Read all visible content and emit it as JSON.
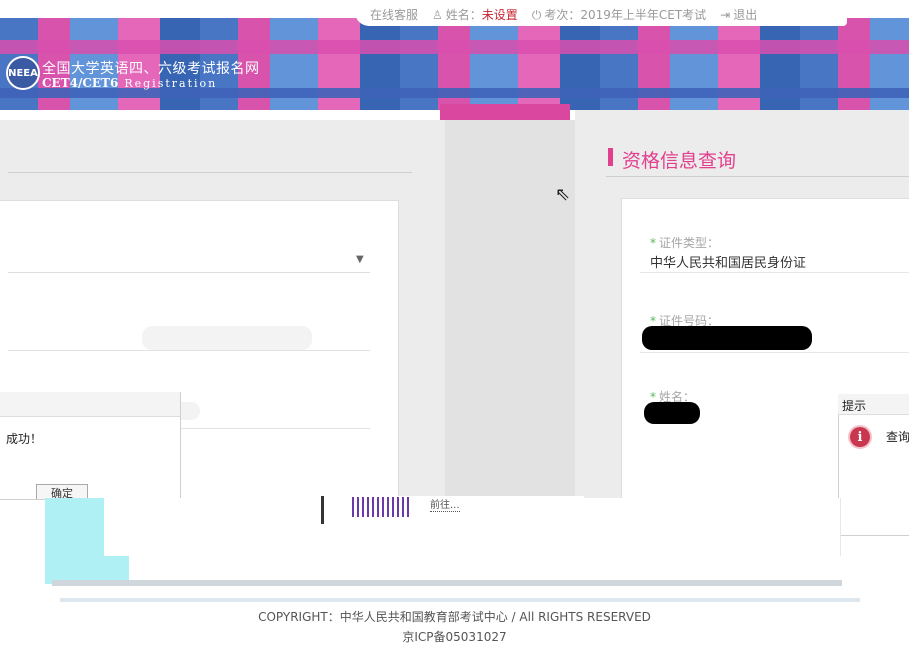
{
  "header": {
    "site_title": "全国大学英语四、六级考试报名网",
    "site_subtitle": "CET4/CET6",
    "site_subtitle_en": "Registration",
    "logo_text": "NEEA",
    "topbar": {
      "customer_service": "在线客服",
      "name_label": "姓名：",
      "name_value": "未设置",
      "exam_label": "考次：2019年上半年CET考试",
      "logout": "退出"
    }
  },
  "right_panel": {
    "title": "资格信息查询",
    "fields": {
      "id_type_label": "证件类型：",
      "id_type_value": "中华人民共和国居民身份证",
      "id_number_label": "证件号码：",
      "name_label": "姓名："
    }
  },
  "left_dialog": {
    "message": "成功！",
    "button": "确定"
  },
  "right_dialog": {
    "title": "提示",
    "message": "查询"
  },
  "glitch_text": "前往...",
  "footer": {
    "copyright": "COPYRIGHT：中华人民共和国教育部考试中心 / All RIGHTS RESERVED",
    "icp": "京ICP备05031027"
  },
  "colors": {
    "accent": "#e2408f",
    "banner_blue": "#3f6fc2",
    "banner_pink": "#d64aa8",
    "alert_red": "#c8242f"
  },
  "icons": [
    "user-icon",
    "power-icon",
    "logout-icon",
    "dropdown-arrow-icon",
    "info-icon",
    "mouse-cursor-icon"
  ]
}
